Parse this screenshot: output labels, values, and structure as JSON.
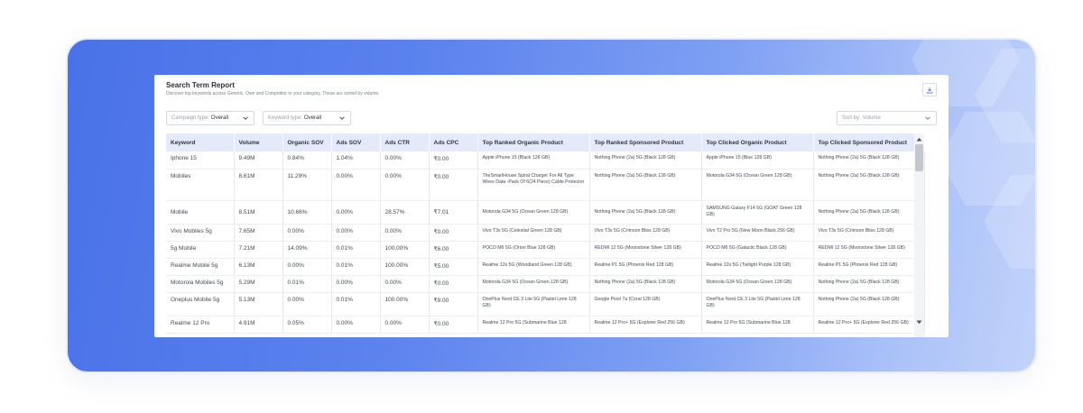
{
  "report": {
    "title": "Search Term Report",
    "subtitle": "Discover top keywords across Generic, Own and Competitor in your category. These are sorted by volume."
  },
  "filters": {
    "campaign_type_label": "Campaign type:",
    "campaign_type_value": "Overall",
    "keyword_type_label": "Keyword type:",
    "keyword_type_value": "Overall",
    "sort_by_label": "Sort by:",
    "sort_by_value": "Volume"
  },
  "icons": {
    "download": "download-icon",
    "chevron": "chevron-down-icon"
  },
  "colors": {
    "accent_blue": "#4a72e8",
    "header_bg": "#e4eaf9"
  },
  "table": {
    "columns": [
      "Keyword",
      "Volume",
      "Organic SOV",
      "Ads SOV",
      "Ads CTR",
      "Ads CPC",
      "Top Ranked Organic Product",
      "Top Ranked Sponsored Product",
      "Top Clicked Organic Product",
      "Top Clicked Sponsored Product"
    ],
    "rows": [
      [
        "Iphone 15",
        "9.49M",
        "0.84%",
        "1.04%",
        "0.00%",
        "₹0.00",
        "Apple iPhone 15 (Black 128 GB)",
        "Nothing Phone (2a) 5G (Black 128 GB)",
        "Apple iPhone 15 (Blue 128 GB)",
        "Nothing Phone (2a) 5G (Black 128 GB)"
      ],
      [
        "Mobiles",
        "8.61M",
        "11.29%",
        "0.00%",
        "0.00%",
        "₹0.00",
        "TheSmartHouse Spiral Charger For All Type Wires Data -Pack Of 6(24 Piece) Cable Protector",
        "Nothing Phone (2a) 5G (Black 128 GB)",
        "Motorola G34 5G (Ocean Green 128 GB)",
        "Nothing Phone (2a) 5G (Black 128 GB)"
      ],
      [
        "Mobile",
        "8.51M",
        "10.66%",
        "0.00%",
        "28.57%",
        "₹7.01",
        "Motorola G34 5G (Ocean Green 128 GB)",
        "Nothing Phone (2a) 5G (Black 128 GB)",
        "SAMSUNG Galaxy F14 5G (GOAT Green 128 GB)",
        "Nothing Phone (2a) 5G (Black 128 GB)"
      ],
      [
        "Vivo Mobiles 5g",
        "7.65M",
        "0.00%",
        "0.00%",
        "0.00%",
        "₹0.00",
        "Vivo T3x 5G (Celestial Green 128 GB)",
        "Vivo T3x 5G (Crimson Bliss 128 GB)",
        "Vivo T2 Pro 5G (New Moon Black 256 GB)",
        "Vivo T3x 5G (Crimson Bliss 128 GB)"
      ],
      [
        "5g Mobile",
        "7.21M",
        "14.09%",
        "0.01%",
        "100.00%",
        "₹6.00",
        "POCO M6 5G (Orion Blue 128 GB)",
        "REDMI 12 5G (Moonstone Silver 128 GB)",
        "POCO M6 5G (Galactic Black 128 GB)",
        "REDMI 12 5G (Moonstone Silver 128 GB)"
      ],
      [
        "Realme Mobile 5g",
        "6.13M",
        "0.00%",
        "0.01%",
        "100.00%",
        "₹5.00",
        "Realme 12x 5G (Woodland Green 128 GB)",
        "Realme P1 5G (Phoenix Red 128 GB)",
        "Realme 12x 5G (Twilight Purple 128 GB)",
        "Realme P1 5G (Phoenix Red 128 GB)"
      ],
      [
        "Motorola Mobiles 5g",
        "5.29M",
        "0.01%",
        "0.00%",
        "0.00%",
        "₹0.00",
        "Motorola G34 5G (Ocean Green 128 GB)",
        "Nothing Phone (2a) 5G (Black 128 GB)",
        "Motorola G34 5G (Ocean Green 128 GB)",
        "Nothing Phone (2a) 5G (Black 128 GB)"
      ],
      [
        "Oneplus Mobile 5g",
        "5.13M",
        "0.00%",
        "0.01%",
        "100.00%",
        "₹9.00",
        "OnePlus Nord CE 3 Lite 5G (Pastel Lime 128 GB)",
        "Google Pixel 7a (Coral 128 GB)",
        "OnePlus Nord CE 3 Lite 5G (Pastel Lime 128 GB)",
        "Nothing Phone (2a) 5G (Black 128 GB)"
      ],
      [
        "Realme 12 Pro",
        "4.91M",
        "0.05%",
        "0.00%",
        "0.00%",
        "₹0.00",
        "Realme 12 Pro 5G (Submarine Blue 128",
        "Realme 12 Pro+ 5G (Explorer Red 256 GB)",
        "Realme 12 Pro 5G (Submarine Blue 128",
        "Realme 12 Pro+ 5G (Explorer Red 256 GB)"
      ]
    ]
  }
}
